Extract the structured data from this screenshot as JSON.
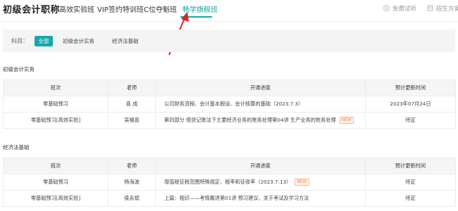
{
  "header": {
    "brand": "初级会计职称",
    "nav": [
      "高效实验班",
      "VIP签约特训班",
      "C位夺魁班",
      "畅学旗舰班"
    ],
    "active_nav": "畅学旗舰班",
    "free_trial": "免费试听",
    "enroll_plan": "招生方案"
  },
  "filter": {
    "label": "科目：",
    "options": [
      "全部",
      "初级会计实务",
      "经济法基础"
    ],
    "selected": "全部"
  },
  "columns": [
    "班次",
    "老师",
    "开通进度",
    "预计更新时间"
  ],
  "sections": [
    {
      "title": "初级会计实务",
      "rows": [
        {
          "class": "零基础预习",
          "teacher": "喜  成",
          "progress": "公司财务流程、会计基本假设、会计核算的基础（2023.7.3）",
          "new": "",
          "update": "2023年07月24日"
        },
        {
          "class": "零基础预习[高效实验]",
          "teacher": "吴福喜",
          "progress": "第四部分   借贷记账法下主要经济业务的账务处理第04讲   生产业务的账务处理",
          "new": "NEW",
          "update": "待定"
        }
      ]
    },
    {
      "title": "经济法基础",
      "rows": [
        {
          "class": "零基础预习",
          "teacher": "杨海波",
          "progress": "增值税征税范围特殊规定、税率和征收率（2023.7.13）",
          "new": "NEW",
          "update": "待定"
        },
        {
          "class": "零基础预习[高效实验]",
          "teacher": "侯永斌",
          "progress": "上篇：相识——考情概述第01讲   预习建议、关于考试及学习方法",
          "new": "",
          "update": "待定"
        }
      ]
    }
  ],
  "colors": {
    "accent": "#18a7a8",
    "chip_bg": "#17a6ad",
    "arrow": "#e02020",
    "new_tag": "#ff7a2f"
  }
}
